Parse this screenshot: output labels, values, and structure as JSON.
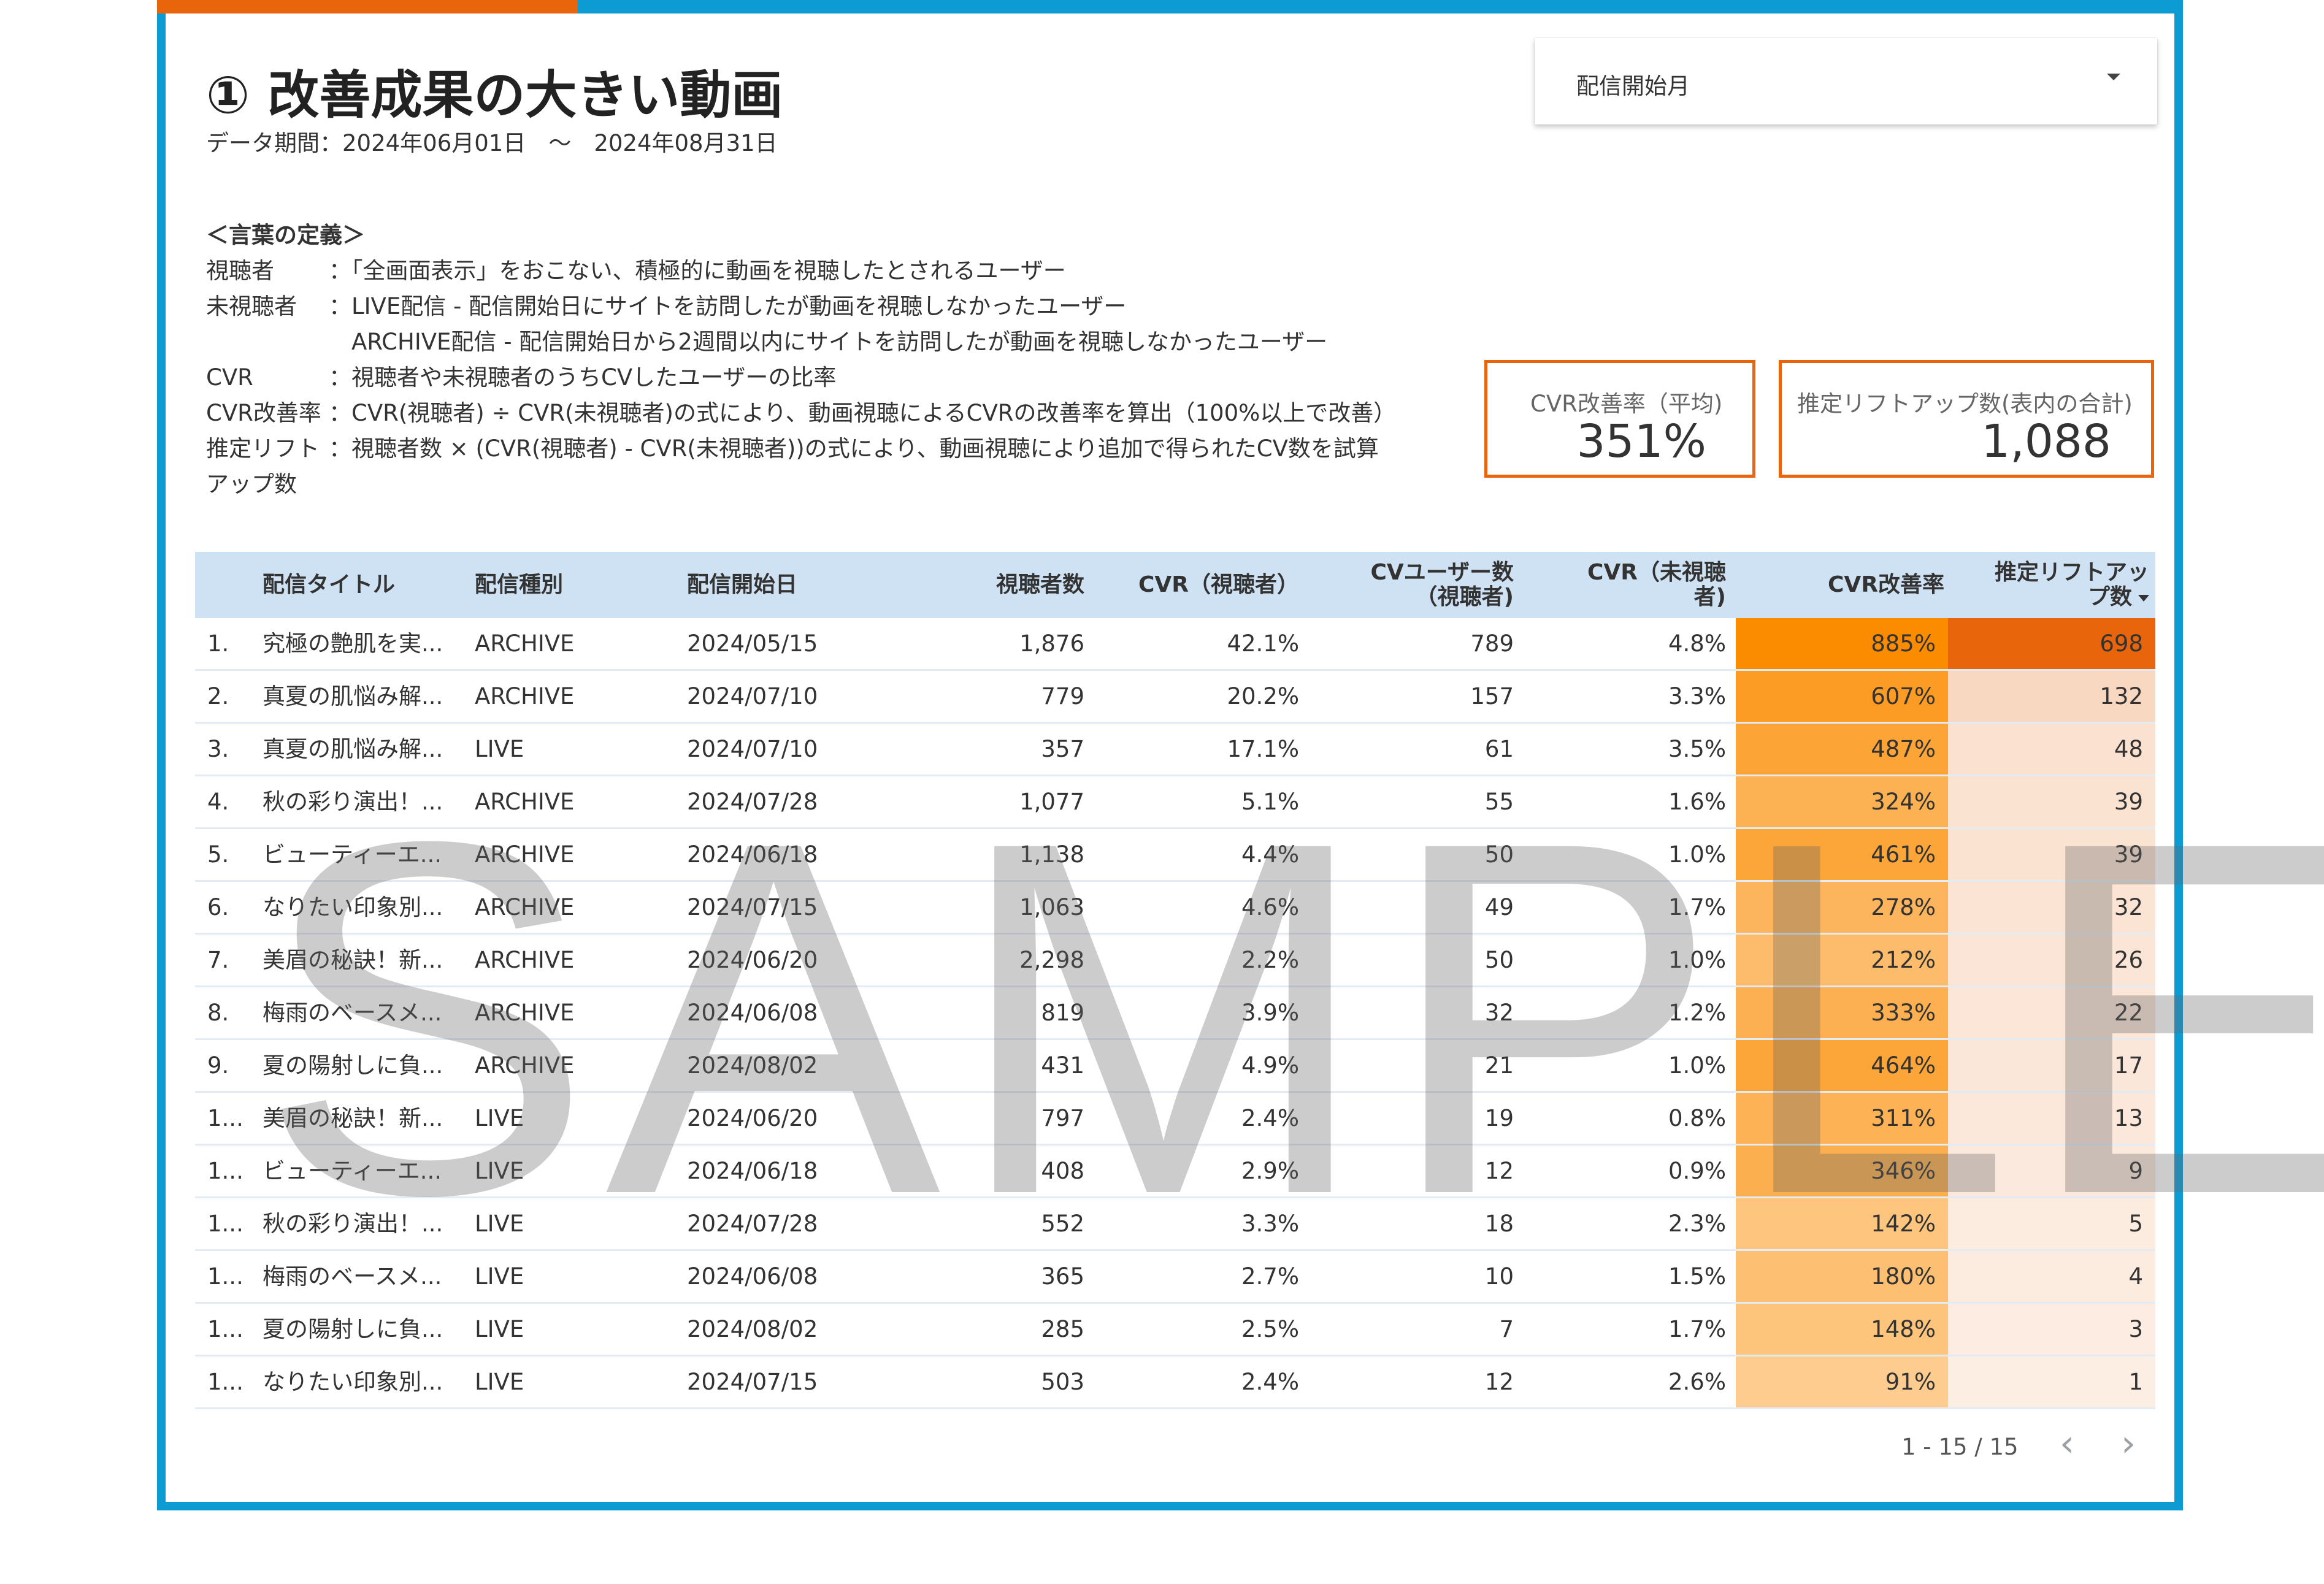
{
  "header": {
    "title": "① 改善成果の大きい動画",
    "period": "データ期間：2024年06月01日　～　2024年08月31日"
  },
  "filter": {
    "label": "配信開始月"
  },
  "definitions": {
    "heading": "＜言葉の定義＞",
    "items": [
      {
        "term": "視聴者",
        "desc": "：「全画面表示」をおこない、積極的に動画を視聴したとされるユーザー"
      },
      {
        "term": "未視聴者",
        "desc": "：LIVE配信 - 配信開始日にサイトを訪問したが動画を視聴しなかったユーザー"
      },
      {
        "term": "",
        "desc": "　ARCHIVE配信 - 配信開始日から2週間以内にサイトを訪問したが動画を視聴しなかったユーザー"
      },
      {
        "term": "CVR",
        "desc": "：視聴者や未視聴者のうちCVしたユーザーの比率"
      },
      {
        "term": "CVR改善率",
        "desc": "：CVR(視聴者) ÷ CVR(未視聴者)の式により、動画視聴によるCVRの改善率を算出（100%以上で改善）"
      },
      {
        "term": "推定リフト",
        "desc": "：視聴者数 × (CVR(視聴者) - CVR(未視聴者))の式により、動画視聴により追加で得られたCV数を試算"
      },
      {
        "term": "アップ数",
        "desc": ""
      }
    ]
  },
  "kpis": {
    "avg_label": "CVR改善率（平均)",
    "avg_value": "351%",
    "sum_label": "推定リフトアップ数(表内の合計)",
    "sum_value": "1,088"
  },
  "table": {
    "columns": {
      "title": "配信タイトル",
      "type": "配信種別",
      "date": "配信開始日",
      "viewers": "視聴者数",
      "cvr_viewer": "CVR（視聴者）",
      "cv_users_1": "CVユーザー数",
      "cv_users_2": "（視聴者)",
      "cvr_non_1": "CVR（未視聴",
      "cvr_non_2": "者)",
      "improve": "CVR改善率",
      "lift_1": "推定リフトアッ",
      "lift_2": "プ数"
    },
    "rows": [
      {
        "no": "1.",
        "title": "究極の艶肌を実...",
        "type": "ARCHIVE",
        "date": "2024/05/15",
        "viewers": "1,876",
        "cvr_viewer": "42.1%",
        "cv_users": "789",
        "cvr_non": "4.8%",
        "improve": "885%",
        "lift": "698"
      },
      {
        "no": "2.",
        "title": "真夏の肌悩み解...",
        "type": "ARCHIVE",
        "date": "2024/07/10",
        "viewers": "779",
        "cvr_viewer": "20.2%",
        "cv_users": "157",
        "cvr_non": "3.3%",
        "improve": "607%",
        "lift": "132"
      },
      {
        "no": "3.",
        "title": "真夏の肌悩み解...",
        "type": "LIVE",
        "date": "2024/07/10",
        "viewers": "357",
        "cvr_viewer": "17.1%",
        "cv_users": "61",
        "cvr_non": "3.5%",
        "improve": "487%",
        "lift": "48"
      },
      {
        "no": "4.",
        "title": "秋の彩り演出！...",
        "type": "ARCHIVE",
        "date": "2024/07/28",
        "viewers": "1,077",
        "cvr_viewer": "5.1%",
        "cv_users": "55",
        "cvr_non": "1.6%",
        "improve": "324%",
        "lift": "39"
      },
      {
        "no": "5.",
        "title": "ビューティーエ...",
        "type": "ARCHIVE",
        "date": "2024/06/18",
        "viewers": "1,138",
        "cvr_viewer": "4.4%",
        "cv_users": "50",
        "cvr_non": "1.0%",
        "improve": "461%",
        "lift": "39"
      },
      {
        "no": "6.",
        "title": "なりたい印象別...",
        "type": "ARCHIVE",
        "date": "2024/07/15",
        "viewers": "1,063",
        "cvr_viewer": "4.6%",
        "cv_users": "49",
        "cvr_non": "1.7%",
        "improve": "278%",
        "lift": "32"
      },
      {
        "no": "7.",
        "title": "美眉の秘訣！新...",
        "type": "ARCHIVE",
        "date": "2024/06/20",
        "viewers": "2,298",
        "cvr_viewer": "2.2%",
        "cv_users": "50",
        "cvr_non": "1.0%",
        "improve": "212%",
        "lift": "26"
      },
      {
        "no": "8.",
        "title": "梅雨のベースメ...",
        "type": "ARCHIVE",
        "date": "2024/06/08",
        "viewers": "819",
        "cvr_viewer": "3.9%",
        "cv_users": "32",
        "cvr_non": "1.2%",
        "improve": "333%",
        "lift": "22"
      },
      {
        "no": "9.",
        "title": "夏の陽射しに負...",
        "type": "ARCHIVE",
        "date": "2024/08/02",
        "viewers": "431",
        "cvr_viewer": "4.9%",
        "cv_users": "21",
        "cvr_non": "1.0%",
        "improve": "464%",
        "lift": "17"
      },
      {
        "no": "1...",
        "title": "美眉の秘訣！新...",
        "type": "LIVE",
        "date": "2024/06/20",
        "viewers": "797",
        "cvr_viewer": "2.4%",
        "cv_users": "19",
        "cvr_non": "0.8%",
        "improve": "311%",
        "lift": "13"
      },
      {
        "no": "1...",
        "title": "ビューティーエ...",
        "type": "LIVE",
        "date": "2024/06/18",
        "viewers": "408",
        "cvr_viewer": "2.9%",
        "cv_users": "12",
        "cvr_non": "0.9%",
        "improve": "346%",
        "lift": "9"
      },
      {
        "no": "1...",
        "title": "秋の彩り演出！...",
        "type": "LIVE",
        "date": "2024/07/28",
        "viewers": "552",
        "cvr_viewer": "3.3%",
        "cv_users": "18",
        "cvr_non": "2.3%",
        "improve": "142%",
        "lift": "5"
      },
      {
        "no": "1...",
        "title": "梅雨のベースメ...",
        "type": "LIVE",
        "date": "2024/06/08",
        "viewers": "365",
        "cvr_viewer": "2.7%",
        "cv_users": "10",
        "cvr_non": "1.5%",
        "improve": "180%",
        "lift": "4"
      },
      {
        "no": "1...",
        "title": "夏の陽射しに負...",
        "type": "LIVE",
        "date": "2024/08/02",
        "viewers": "285",
        "cvr_viewer": "2.5%",
        "cv_users": "7",
        "cvr_non": "1.7%",
        "improve": "148%",
        "lift": "3"
      },
      {
        "no": "1...",
        "title": "なりたい印象別...",
        "type": "LIVE",
        "date": "2024/07/15",
        "viewers": "503",
        "cvr_viewer": "2.4%",
        "cv_users": "12",
        "cvr_non": "2.6%",
        "improve": "91%",
        "lift": "1"
      }
    ],
    "improve_values": [
      885,
      607,
      487,
      324,
      461,
      278,
      212,
      333,
      464,
      311,
      346,
      142,
      180,
      148,
      91
    ],
    "lift_values": [
      698,
      132,
      48,
      39,
      39,
      32,
      26,
      22,
      17,
      13,
      9,
      5,
      4,
      3,
      1
    ],
    "heat_color_improve": "#fb8c00",
    "heat_color_lift": "#e8650b"
  },
  "pager": {
    "text": "1 - 15 / 15",
    "prev_icon": "chevron-left-icon",
    "next_icon": "chevron-right-icon"
  },
  "watermark": "SAMPLE",
  "colors": {
    "frame": "#0d9bd3",
    "accent": "#e8650b",
    "header_bg": "#cfe2f3"
  }
}
